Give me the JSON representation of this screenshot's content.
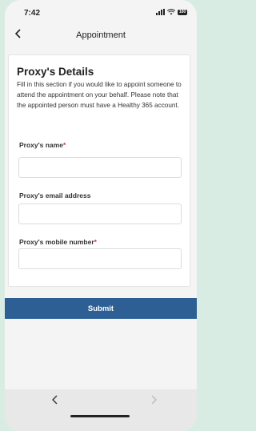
{
  "status_bar": {
    "time": "7:42",
    "battery": "100"
  },
  "header": {
    "back_icon": "chevron-left-icon",
    "title": "Appointment"
  },
  "proxy_section": {
    "title": "Proxy's Details",
    "description": "Fill in this section if you would like to appoint someone to attend the appointment on your behalf. Please note that the appointed person must have a Healthy 365 account.",
    "fields": [
      {
        "label": "Proxy's name",
        "required": "*",
        "value": "",
        "placeholder": ""
      },
      {
        "label": "Proxy's email address",
        "required": "",
        "value": "",
        "placeholder": ""
      },
      {
        "label": "Proxy's mobile number",
        "required": "*",
        "value": "",
        "placeholder": ""
      }
    ]
  },
  "submit_label": "Submit",
  "browser_toolbar": {
    "back_icon": "chevron-left-icon",
    "forward_icon": "chevron-right-icon"
  },
  "colors": {
    "accent": "#2d5f95",
    "required": "#d23a3a",
    "background": "#d9ece4"
  }
}
